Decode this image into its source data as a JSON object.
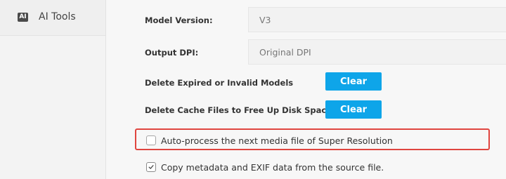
{
  "sidebar": {
    "items": [
      {
        "icon": "ai-tools-icon",
        "icon_text": "AI",
        "label": "AI Tools"
      }
    ]
  },
  "settings": {
    "model_version": {
      "label": "Model Version:",
      "value": "V3"
    },
    "output_dpi": {
      "label": "Output DPI:",
      "value": "Original DPI"
    },
    "delete_expired": {
      "label": "Delete Expired or Invalid Models",
      "button": "Clear"
    },
    "delete_cache": {
      "label": "Delete Cache Files to Free Up Disk Space",
      "button": "Clear"
    },
    "auto_process": {
      "label": "Auto-process the next media file of Super Resolution",
      "checked": false
    },
    "copy_metadata": {
      "label": "Copy metadata and EXIF data from the source file.",
      "checked": true
    }
  },
  "colors": {
    "accent": "#0ea5e9",
    "highlight_border": "#e0453f"
  }
}
